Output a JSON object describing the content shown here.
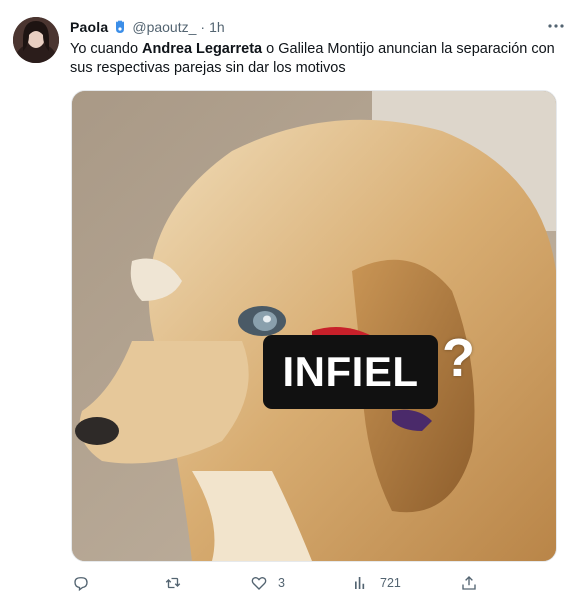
{
  "tweet": {
    "display_name": "Paola",
    "handle": "@paoutz_",
    "separator": "·",
    "time": "1h",
    "text_parts": {
      "part1": "Yo cuando ",
      "mention1": "Andrea Legarreta",
      "part2": " o Galilea Montijo anuncian la separación con sus respectivas parejas sin dar los motivos"
    },
    "media": {
      "overlay_label": "INFIEL",
      "overlay_mark": "?"
    },
    "actions": {
      "reply": {
        "icon": "reply-icon",
        "count": ""
      },
      "retweet": {
        "icon": "retweet-icon",
        "count": ""
      },
      "like": {
        "icon": "heart-icon",
        "count": "3"
      },
      "views": {
        "icon": "views-icon",
        "count": "721"
      },
      "share": {
        "icon": "share-icon",
        "count": ""
      }
    }
  },
  "colors": {
    "text_primary": "#0f1419",
    "text_secondary": "#536471",
    "verified_badge": "#1d9bf0"
  }
}
